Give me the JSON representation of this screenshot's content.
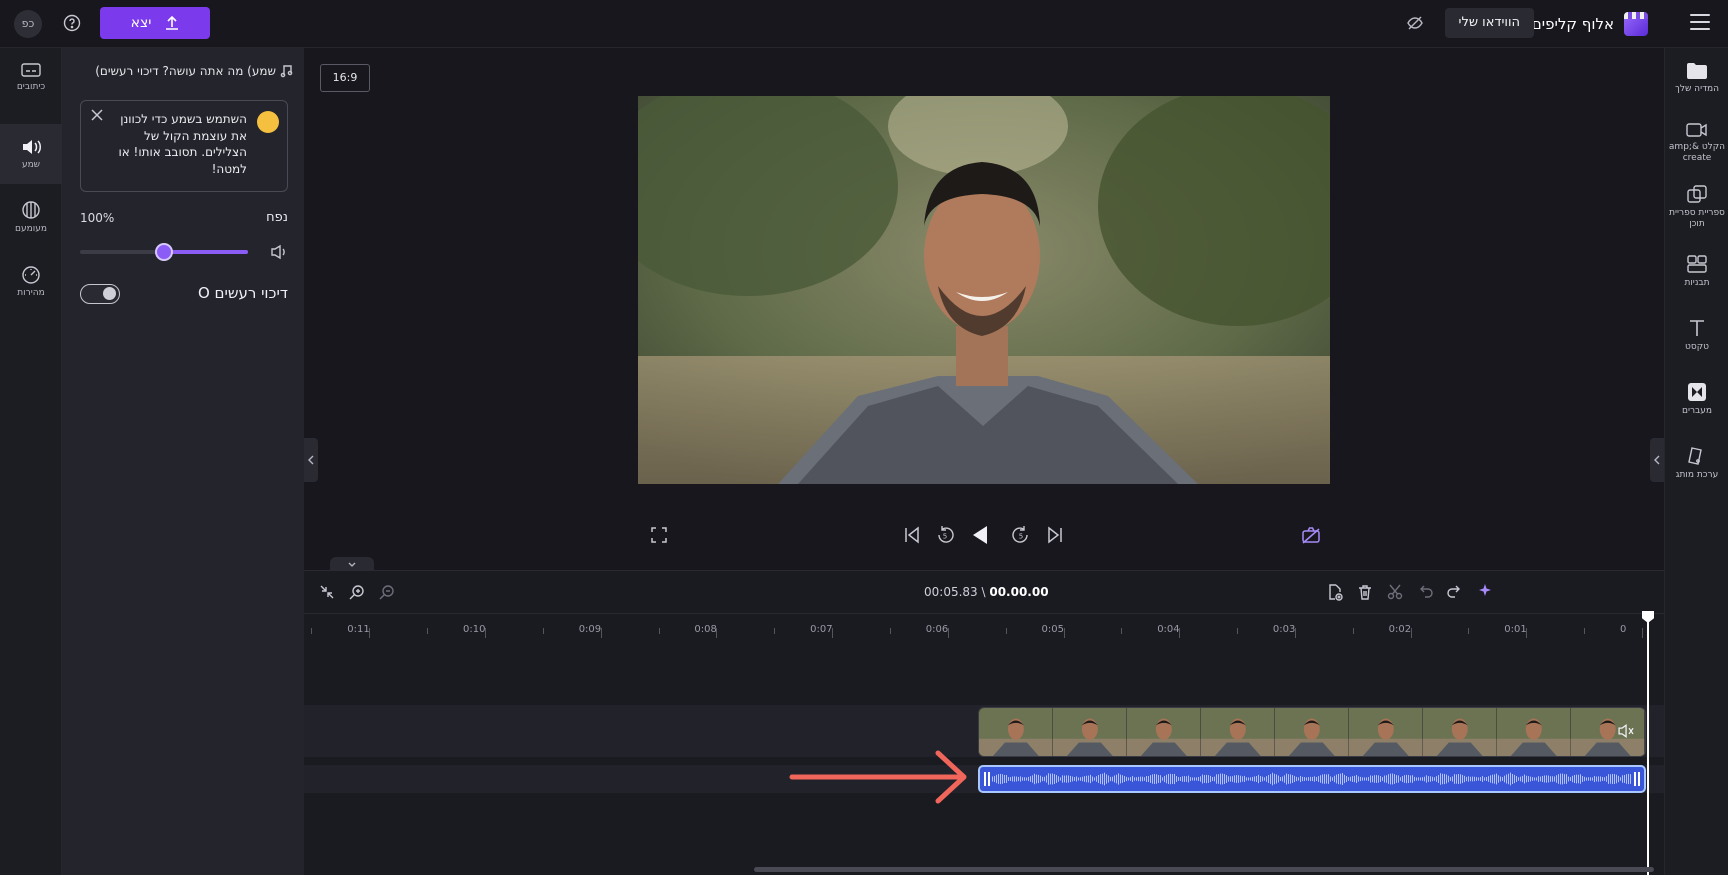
{
  "topbar": {
    "brand_name": "אלוף קליפים",
    "my_videos": "הווידאו שלי",
    "export_label": "יצא",
    "avatar_initials": "כפ"
  },
  "left_strip": {
    "items": [
      {
        "label": "כיתובים",
        "icon": "captions-icon"
      },
      {
        "label": "שמע",
        "icon": "speaker-icon"
      },
      {
        "label": "מעומעם",
        "icon": "fade-icon"
      },
      {
        "label": "מהירות",
        "icon": "speed-gauge-icon"
      }
    ]
  },
  "panel": {
    "title": "שמע) מה אתה עושה? דיכוי רעשים)",
    "tip": "השתמש בשמע כדי לכוונן את עוצמת הקול של הצלילים. תסובב אותו! או למטה!",
    "volume_label": "נפח",
    "volume_value": "100%",
    "volume_level": 0.5,
    "denoise_label": "דיכוי רעשים O"
  },
  "stage": {
    "aspect_ratio": "16:9"
  },
  "right_bar": {
    "items": [
      {
        "label": "המדיה שלך",
        "icon": "folder-icon"
      },
      {
        "label": "הקלט &amp; create",
        "icon": "record-icon"
      },
      {
        "label": "ספריית ספריית תוכן",
        "icon": "library-icon"
      },
      {
        "label": "תבניות",
        "icon": "templates-icon"
      },
      {
        "label": "טקסט",
        "icon": "text-icon"
      },
      {
        "label": "מעברים",
        "icon": "transitions-icon"
      },
      {
        "label": "ערכת מותג",
        "icon": "brand-kit-icon"
      }
    ]
  },
  "timeline": {
    "current_time": "00.00.00",
    "total_time": "00:05.83",
    "separator": " \\ ",
    "ruler_ticks": [
      "0",
      "0:01",
      "0:02",
      "0:03",
      "0:04",
      "0:05",
      "0:06",
      "0:07",
      "0:08",
      "0:09",
      "0:10",
      "0:11"
    ]
  },
  "colors": {
    "accent": "#7c3aed",
    "audio_clip": "#3a56d8",
    "arrow": "#f0665a"
  }
}
